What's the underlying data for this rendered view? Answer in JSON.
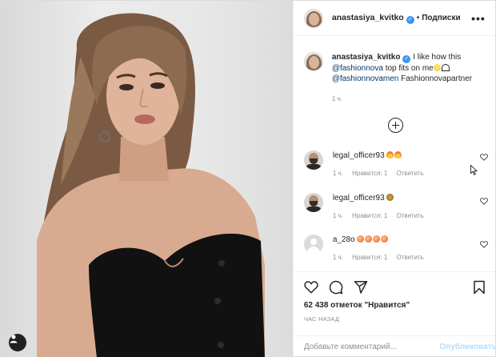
{
  "header": {
    "username": "anastasiya_kvitko",
    "separator": "•",
    "follow_label": "Подписки",
    "more_label": "•••"
  },
  "caption": {
    "username": "anastasiya_kvitko",
    "text_1": "I like how this",
    "mention_1": "@fashionnova",
    "text_2": "top fits on me",
    "mention_2": "@fashionnovamen",
    "text_3": "Fashionnovapartner",
    "time": "1 ч."
  },
  "comments": [
    {
      "username": "legal_officer93",
      "time": "1 ч.",
      "likes": "Нравится: 1",
      "reply": "Ответить",
      "emoji": [
        "fire",
        "fire"
      ]
    },
    {
      "username": "legal_officer93",
      "time": "1 ч.",
      "likes": "Нравится: 1",
      "reply": "Ответить",
      "emoji": [
        "money"
      ]
    },
    {
      "username": "a_28o",
      "time": "1 ч.",
      "likes": "Нравится: 1",
      "reply": "Ответить",
      "emoji": [
        "peach",
        "peach",
        "peach",
        "peach"
      ]
    }
  ],
  "actions": {
    "likes_text": "62 438 отметок \"Нравится\"",
    "ago": "ЧАС НАЗАД",
    "icons": [
      "heart-icon",
      "comment-icon",
      "share-icon",
      "bookmark-icon"
    ]
  },
  "add_comment": {
    "placeholder": "Добавьте комментарий...",
    "value": "",
    "publish_label": "Опубликовать"
  },
  "colors": {
    "link": "#00376b",
    "verified": "#3897f0",
    "muted": "#8e8e8e",
    "publish_disabled": "#b2dffc",
    "dress": "#111111"
  }
}
